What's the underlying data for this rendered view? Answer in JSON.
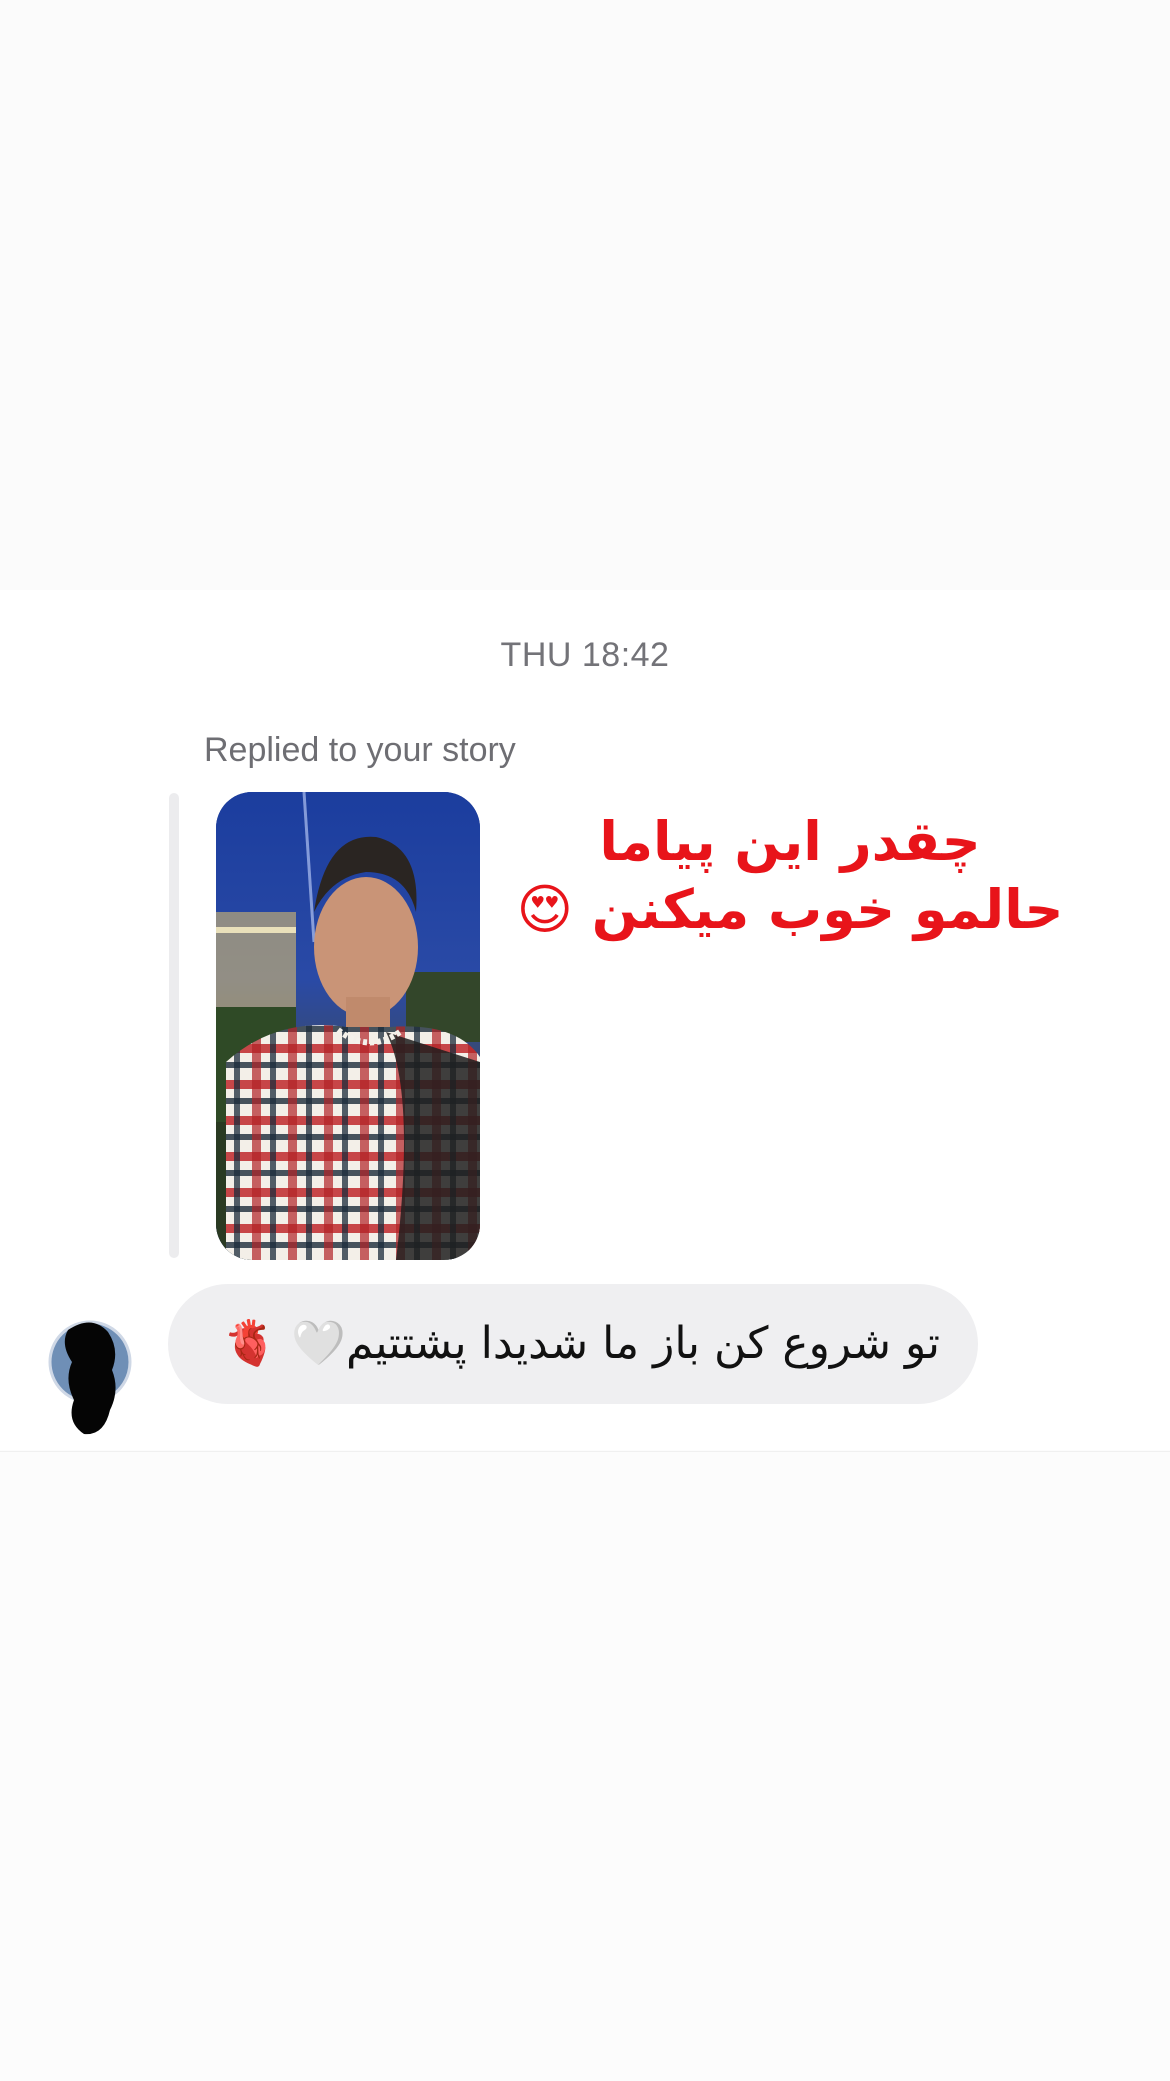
{
  "thread": {
    "timestamp": "THU 18:42",
    "replied_label": "Replied to your story",
    "story": {
      "overlay_lines": [
        "چقدر این پیاما",
        "حالمو خوب میکنن 😍"
      ],
      "overlay_color": "#e8141a"
    },
    "message": {
      "text": "تو شروع کن باز ما شدیدا پشتتیم🤍 🫀",
      "bubble_color": "#efeff1"
    }
  },
  "icons": {
    "avatar": "avatar-icon",
    "story_thumbnail": "story-thumbnail-image"
  }
}
